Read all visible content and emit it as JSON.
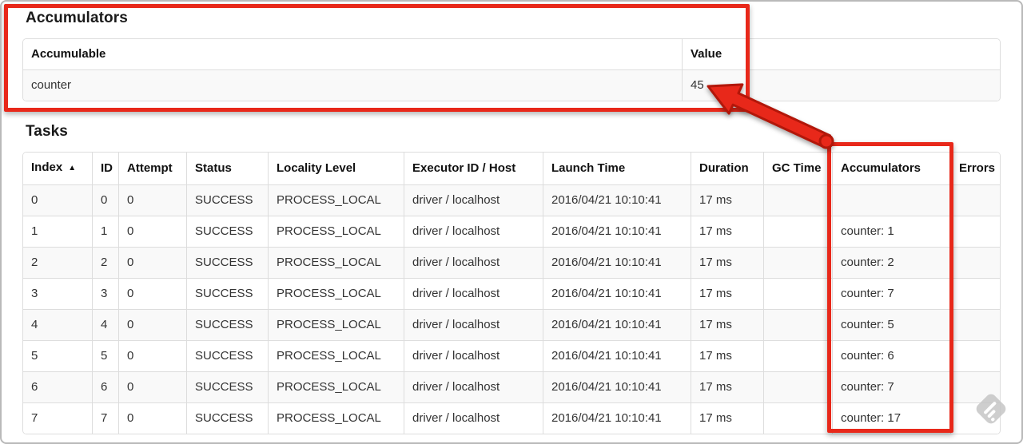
{
  "accumulators_section": {
    "heading": "Accumulators",
    "table": {
      "headers": {
        "accumulable": "Accumulable",
        "value": "Value"
      },
      "rows": [
        {
          "accumulable": "counter",
          "value": "45"
        }
      ]
    }
  },
  "tasks_section": {
    "heading": "Tasks",
    "table": {
      "headers": {
        "index": "Index",
        "id": "ID",
        "attempt": "Attempt",
        "status": "Status",
        "locality": "Locality Level",
        "executor": "Executor ID / Host",
        "launch": "Launch Time",
        "duration": "Duration",
        "gc": "GC Time",
        "accumulators": "Accumulators",
        "errors": "Errors"
      },
      "sort_indicator": "▲",
      "rows": [
        {
          "index": "0",
          "id": "0",
          "attempt": "0",
          "status": "SUCCESS",
          "locality": "PROCESS_LOCAL",
          "executor": "driver / localhost",
          "launch": "2016/04/21 10:10:41",
          "duration": "17 ms",
          "gc": "",
          "accumulators": "",
          "errors": ""
        },
        {
          "index": "1",
          "id": "1",
          "attempt": "0",
          "status": "SUCCESS",
          "locality": "PROCESS_LOCAL",
          "executor": "driver / localhost",
          "launch": "2016/04/21 10:10:41",
          "duration": "17 ms",
          "gc": "",
          "accumulators": "counter: 1",
          "errors": ""
        },
        {
          "index": "2",
          "id": "2",
          "attempt": "0",
          "status": "SUCCESS",
          "locality": "PROCESS_LOCAL",
          "executor": "driver / localhost",
          "launch": "2016/04/21 10:10:41",
          "duration": "17 ms",
          "gc": "",
          "accumulators": "counter: 2",
          "errors": ""
        },
        {
          "index": "3",
          "id": "3",
          "attempt": "0",
          "status": "SUCCESS",
          "locality": "PROCESS_LOCAL",
          "executor": "driver / localhost",
          "launch": "2016/04/21 10:10:41",
          "duration": "17 ms",
          "gc": "",
          "accumulators": "counter: 7",
          "errors": ""
        },
        {
          "index": "4",
          "id": "4",
          "attempt": "0",
          "status": "SUCCESS",
          "locality": "PROCESS_LOCAL",
          "executor": "driver / localhost",
          "launch": "2016/04/21 10:10:41",
          "duration": "17 ms",
          "gc": "",
          "accumulators": "counter: 5",
          "errors": ""
        },
        {
          "index": "5",
          "id": "5",
          "attempt": "0",
          "status": "SUCCESS",
          "locality": "PROCESS_LOCAL",
          "executor": "driver / localhost",
          "launch": "2016/04/21 10:10:41",
          "duration": "17 ms",
          "gc": "",
          "accumulators": "counter: 6",
          "errors": ""
        },
        {
          "index": "6",
          "id": "6",
          "attempt": "0",
          "status": "SUCCESS",
          "locality": "PROCESS_LOCAL",
          "executor": "driver / localhost",
          "launch": "2016/04/21 10:10:41",
          "duration": "17 ms",
          "gc": "",
          "accumulators": "counter: 7",
          "errors": ""
        },
        {
          "index": "7",
          "id": "7",
          "attempt": "0",
          "status": "SUCCESS",
          "locality": "PROCESS_LOCAL",
          "executor": "driver / localhost",
          "launch": "2016/04/21 10:10:41",
          "duration": "17 ms",
          "gc": "",
          "accumulators": "counter: 17",
          "errors": ""
        }
      ]
    }
  },
  "annotations": {
    "highlight_color": "#e8281a",
    "outline_color": "#b2170a",
    "watermark_color": "#c6c6c6"
  }
}
